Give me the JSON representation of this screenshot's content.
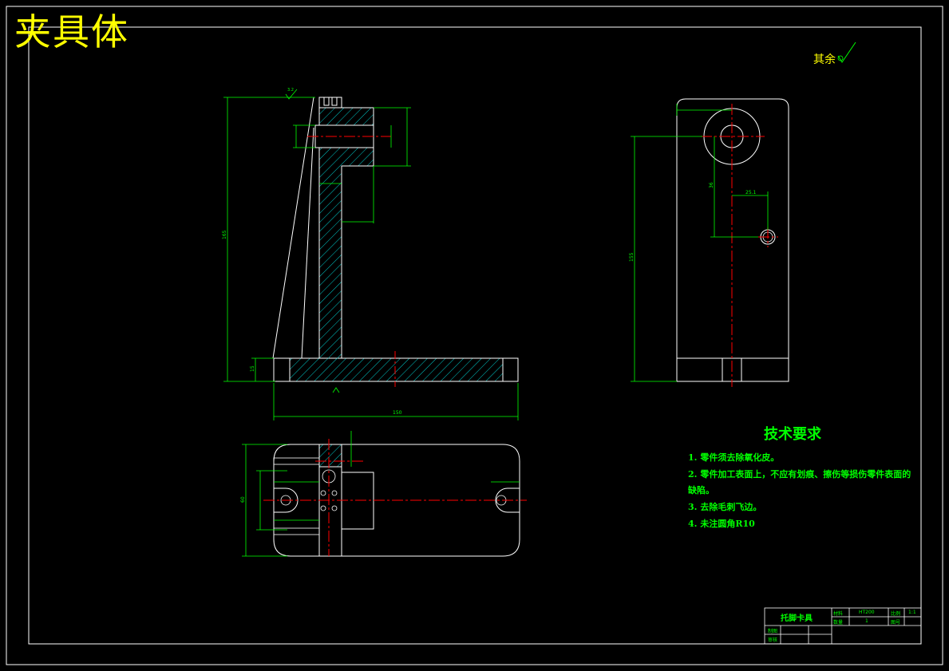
{
  "drawing": {
    "title": "夹具体",
    "roughness_note": "其余",
    "colors": {
      "background": "#000000",
      "outline": "#ffffff",
      "dimension": "#00ff00",
      "centerline": "#ff0000",
      "hatch": "#00ffff",
      "title_text": "#ffff00"
    }
  },
  "dimensions": {
    "front_overall_height": "165",
    "front_base_width": "150",
    "front_base_height": "15",
    "side_height": "155",
    "side_offset": "36",
    "side_hole_offset": "25.1",
    "plan_width": "60",
    "roughness_value": "3.2"
  },
  "tech_requirements": {
    "title": "技术要求",
    "items": [
      "1. 零件须去除氧化皮。",
      "2. 零件加工表面上，不应有划痕、擦伤等损伤零件表面的",
      "缺陷。",
      "3. 去除毛刺飞边。",
      "4. 未注圆角R10"
    ]
  },
  "title_block": {
    "part_name": "托脚卡具",
    "material_label": "材料",
    "material_value": "HT200",
    "scale_label": "比例",
    "scale_value": "1:1",
    "quantity_label": "数量",
    "quantity_value": "1",
    "drawing_no_label": "图号",
    "designer_label": "制图",
    "checker_label": "审核"
  }
}
